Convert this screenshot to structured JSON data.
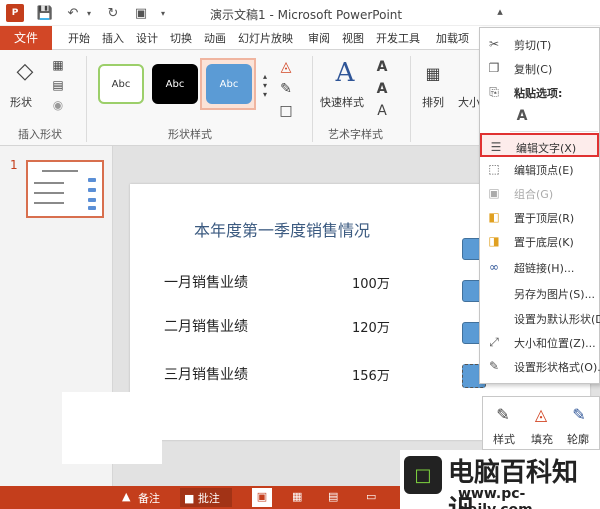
{
  "app": {
    "badge": "P",
    "window_title": "演示文稿1 - Microsoft PowerPoint",
    "window_buttons": [
      "?",
      "□",
      "–",
      "□",
      "✕"
    ]
  },
  "tabs": {
    "file": "文件",
    "items": [
      "开始",
      "插入",
      "设计",
      "切换",
      "动画",
      "幻灯片放映",
      "审阅",
      "视图",
      "开发工具",
      "加载项"
    ]
  },
  "ribbon": {
    "shape_label": "形状",
    "insert_shapes_group": "插入形状",
    "style_samples": [
      "Abc",
      "Abc",
      "Abc"
    ],
    "shape_styles_group": "形状样式",
    "quick_styles": "快速样式",
    "wordart_group": "艺术字样式",
    "arrange": "排列",
    "size_partial": "大小"
  },
  "pane": {
    "slide_number": "1"
  },
  "slide": {
    "title": "本年度第一季度销售情况",
    "rows": [
      {
        "label": "一月销售业绩",
        "value": "100万"
      },
      {
        "label": "二月销售业绩",
        "value": "120万"
      },
      {
        "label": "三月销售业绩",
        "value": "156万"
      }
    ]
  },
  "context_menu": {
    "items": [
      {
        "icon": "cut-icon",
        "glyph": "✂",
        "label": "剪切(T)",
        "disabled": false
      },
      {
        "icon": "copy-icon",
        "glyph": "❐",
        "label": "复制(C)",
        "disabled": false
      },
      {
        "icon": "paste-icon",
        "glyph": "⎘",
        "label": "粘贴选项:",
        "disabled": false
      },
      {
        "icon": "paste-text-icon",
        "glyph": "A",
        "label": "",
        "disabled": false
      },
      {
        "icon": "edit-text-icon",
        "glyph": "☰",
        "label": "编辑文字(X)",
        "disabled": false,
        "highlight": true
      },
      {
        "icon": "edit-points-icon",
        "glyph": "⬚",
        "label": "编辑顶点(E)",
        "disabled": false
      },
      {
        "icon": "group-icon",
        "glyph": "▣",
        "label": "组合(G)",
        "disabled": true
      },
      {
        "icon": "bring-front-icon",
        "glyph": "◧",
        "label": "置于顶层(R)",
        "disabled": false
      },
      {
        "icon": "send-back-icon",
        "glyph": "◨",
        "label": "置于底层(K)",
        "disabled": false
      },
      {
        "icon": "hyperlink-icon",
        "glyph": "∞",
        "label": "超链接(H)...",
        "disabled": false
      },
      {
        "icon": "save-picture-icon",
        "glyph": "",
        "label": "另存为图片(S)...",
        "disabled": false
      },
      {
        "icon": "set-default-icon",
        "glyph": "",
        "label": "设置为默认形状(D)",
        "disabled": false
      },
      {
        "icon": "size-position-icon",
        "glyph": "⤢",
        "label": "大小和位置(Z)...",
        "disabled": false
      },
      {
        "icon": "format-shape-icon",
        "glyph": "✎",
        "label": "设置形状格式(O)...",
        "disabled": false
      }
    ]
  },
  "mini_toolbar": {
    "style": "样式",
    "fill": "填充",
    "outline": "轮廓"
  },
  "status": {
    "notes": "备注",
    "comments": "批注"
  },
  "watermark": {
    "title": "电脑百科知识",
    "url": "www.pc-daily.com"
  },
  "colors": {
    "accent": "#d24726",
    "shape_fill": "#5b9bd5",
    "highlight_border": "#e03131"
  }
}
